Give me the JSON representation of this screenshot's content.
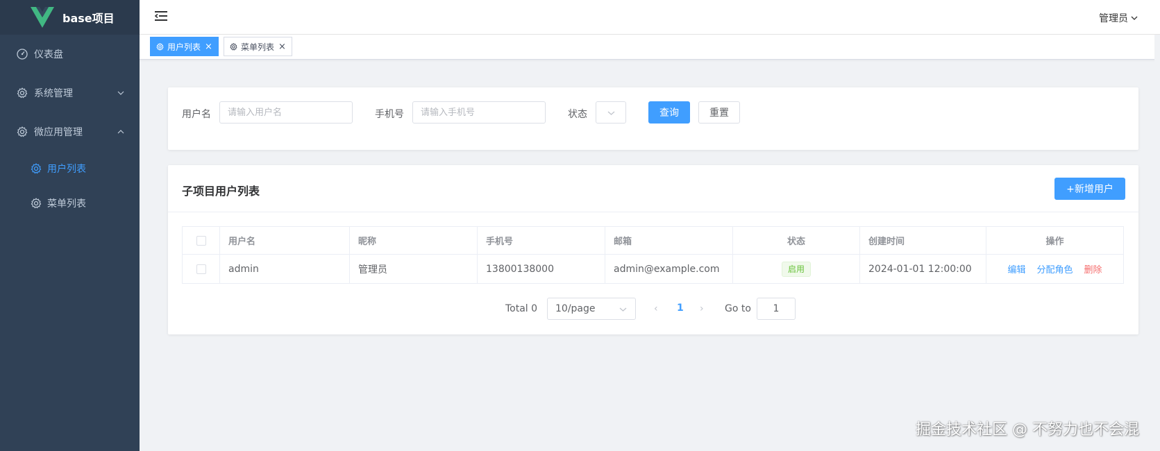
{
  "app": {
    "logo_text": "base项目",
    "brand_color": "#41b883",
    "accent_color": "#409eff"
  },
  "sidebar": {
    "items": [
      {
        "label": "仪表盘",
        "icon": "dashboard-icon"
      },
      {
        "label": "系统管理",
        "icon": "gear-icon",
        "expanded": false
      },
      {
        "label": "微应用管理",
        "icon": "gear-icon",
        "expanded": true,
        "children": [
          {
            "label": "用户列表",
            "icon": "gear-icon",
            "active": true
          },
          {
            "label": "菜单列表",
            "icon": "gear-icon",
            "active": false
          }
        ]
      }
    ]
  },
  "header": {
    "user_label": "管理员",
    "menu_icon": "hamburger-icon"
  },
  "tags": [
    {
      "label": "用户列表",
      "active": true
    },
    {
      "label": "菜单列表",
      "active": false
    }
  ],
  "search": {
    "username_label": "用户名",
    "username_placeholder": "请输入用户名",
    "phone_label": "手机号",
    "phone_placeholder": "请输入手机号",
    "status_label": "状态",
    "query_button": "查询",
    "reset_button": "重置"
  },
  "list": {
    "title": "子项目用户列表",
    "add_button": "+新增用户",
    "columns": [
      "用户名",
      "昵称",
      "手机号",
      "邮箱",
      "状态",
      "创建时间",
      "操作"
    ],
    "rows": [
      {
        "username": "admin",
        "nickname": "管理员",
        "phone": "13800138000",
        "email": "admin@example.com",
        "status": "启用",
        "created_at": "2024-01-01 12:00:00",
        "actions": {
          "edit": "编辑",
          "assign_role": "分配角色",
          "delete": "删除"
        }
      }
    ]
  },
  "pagination": {
    "total_text": "Total 0",
    "page_size": "10/page",
    "current_page": "1",
    "goto_label": "Go to",
    "goto_value": "1"
  },
  "watermark": "掘金技术社区 @ 不努力也不会混"
}
